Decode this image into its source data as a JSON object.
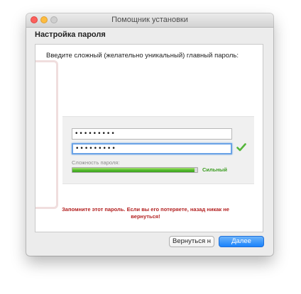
{
  "window": {
    "title": "Помощник установки"
  },
  "section_title": "Настройка пароля",
  "instruction": "Введите сложный (желательно уникальный) главный пароль:",
  "password": {
    "field1_value": "•••••••••",
    "field2_value": "•••••••••",
    "strength_label": "Сложность пароля:",
    "strength_value": "Сильный",
    "strength_fraction": 0.98
  },
  "warning": "Запомните этот пароль. Если вы его потеряете, назад никак не вернуться!",
  "buttons": {
    "back": "Вернуться н",
    "next": "Далее"
  },
  "colors": {
    "accent_blue": "#1a82fb",
    "focus_ring": "#6aa3e6",
    "strength_green": "#3a9c1f",
    "warning_red": "#b32020"
  },
  "icons": {
    "close": "close-icon",
    "minimize": "minimize-icon",
    "maximize": "maximize-icon",
    "check": "checkmark-icon"
  }
}
